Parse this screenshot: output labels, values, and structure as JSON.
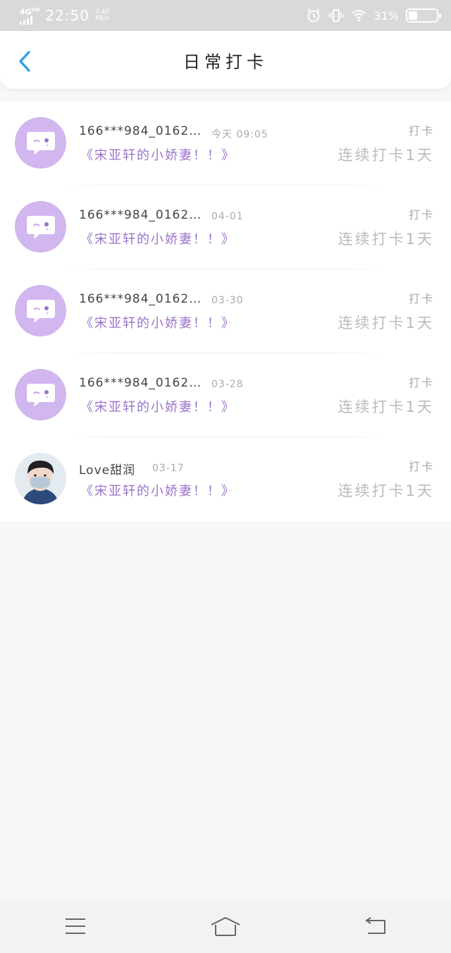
{
  "status_bar": {
    "network": "4G",
    "network_sup": "HD",
    "time": "22:50",
    "speed_value": "3.40",
    "speed_unit": "KB/s",
    "battery_percent": "31%",
    "battery_level": 0.31,
    "icons": [
      "alarm-icon",
      "vibrate-icon",
      "wifi-icon",
      "battery-icon"
    ]
  },
  "header": {
    "title": "日常打卡",
    "back_icon": "chevron-left-icon",
    "accent": "#2b9ce6"
  },
  "list": {
    "items": [
      {
        "name": "166***984_0162…",
        "date": "今天 09:05",
        "book": "《宋亚轩的小娇妻！！》",
        "checkin": "打卡",
        "streak": "连续打卡1天",
        "avatar": "chat-bubble-avatar"
      },
      {
        "name": "166***984_0162…",
        "date": "04-01",
        "book": "《宋亚轩的小娇妻！！》",
        "checkin": "打卡",
        "streak": "连续打卡1天",
        "avatar": "chat-bubble-avatar"
      },
      {
        "name": "166***984_0162…",
        "date": "03-30",
        "book": "《宋亚轩的小娇妻！！》",
        "checkin": "打卡",
        "streak": "连续打卡1天",
        "avatar": "chat-bubble-avatar"
      },
      {
        "name": "166***984_0162…",
        "date": "03-28",
        "book": "《宋亚轩的小娇妻！！》",
        "checkin": "打卡",
        "streak": "连续打卡1天",
        "avatar": "chat-bubble-avatar"
      },
      {
        "name": "Love甜润",
        "date": "03-17",
        "book": "《宋亚轩的小娇妻！！》",
        "checkin": "打卡",
        "streak": "连续打卡1天",
        "avatar": "user-photo-avatar"
      }
    ]
  },
  "colors": {
    "avatar_bg": "#d2b6ef",
    "book_title": "#9a74c9",
    "status_bar_bg": "#d9d9d9"
  },
  "nav": {
    "icons": [
      "menu-icon",
      "home-icon",
      "back-icon"
    ]
  }
}
